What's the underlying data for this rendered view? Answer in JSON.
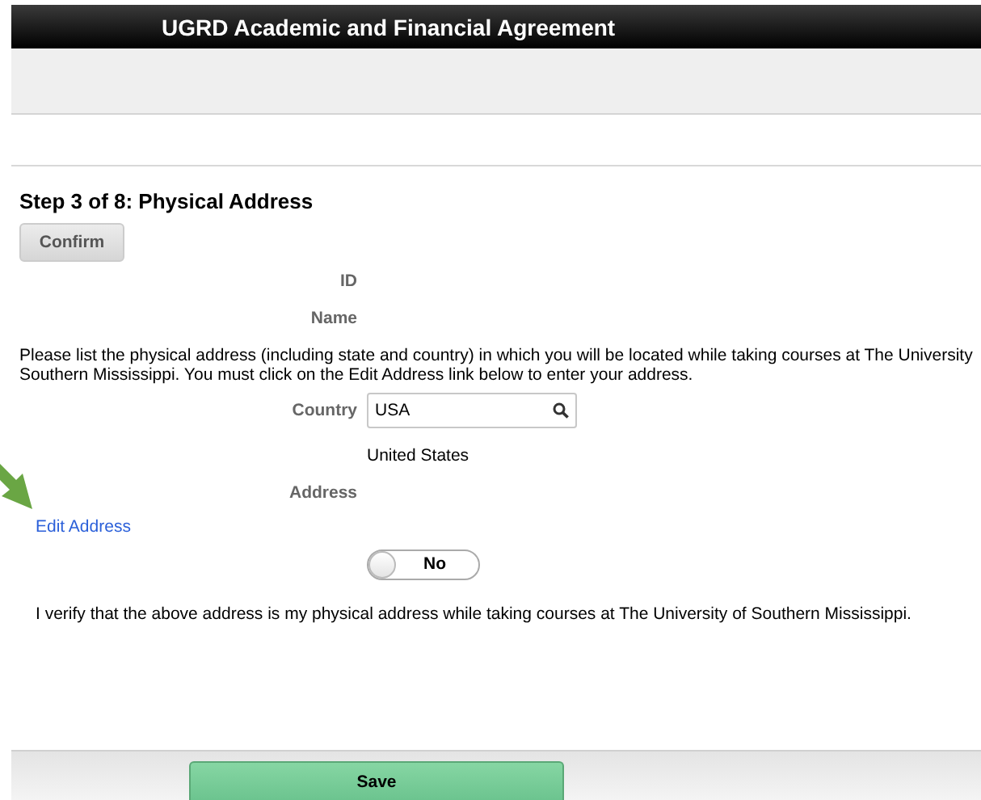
{
  "window": {
    "title": "UGRD Academic and Financial Agreement"
  },
  "step_title": "Step 3 of 8: Physical Address",
  "confirm_button": "Confirm",
  "fields": [
    {
      "kind": "label",
      "label": "ID"
    },
    {
      "kind": "label",
      "label": "Name"
    }
  ],
  "instructions": [
    "Please list the physical address (including state and country) in which you will be located while taking courses at The University",
    "Southern Mississippi. You must click on the Edit Address link below to enter your address."
  ],
  "country": {
    "label": "Country",
    "value": "USA",
    "description": "United States"
  },
  "address": {
    "label": "Address"
  },
  "edit_address_link": "Edit Address",
  "verify_toggle": {
    "label": "No",
    "on": false
  },
  "verify_text": "I verify that the above address is my physical address while taking courses at The University of Southern Mississippi.",
  "save_button": "Save"
}
